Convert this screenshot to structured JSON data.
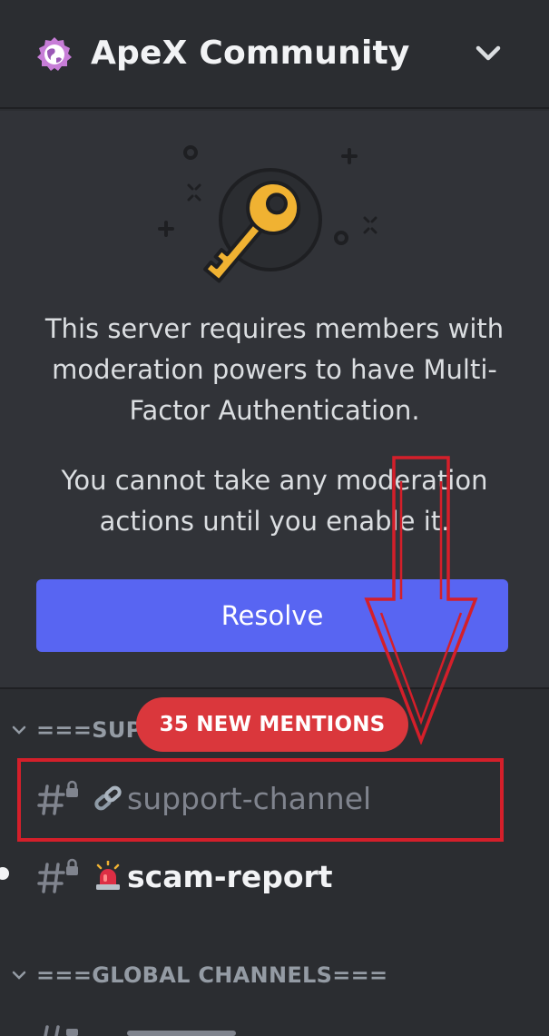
{
  "server": {
    "name": "ApeX Community",
    "icon": "globe-icon",
    "dropdown_icon": "chevron-down-icon"
  },
  "mfa_notice": {
    "illustration": "key-icon",
    "message": "This server requires members with moderation powers to have Multi-Factor Authentication.",
    "warning": "You cannot take any moderation actions until you enable it.",
    "resolve_label": "Resolve"
  },
  "mentions_pill": "35 NEW MENTIONS",
  "categories": [
    {
      "label": "===SUPP",
      "channels": [
        {
          "icon": "locked-hash-icon",
          "emoji": "link-icon",
          "name": "support-channel",
          "unread": false
        },
        {
          "icon": "locked-hash-icon",
          "emoji": "siren-icon",
          "name": "scam-report",
          "unread": true
        }
      ]
    },
    {
      "label": "===GLOBAL CHANNELS===",
      "channels": []
    }
  ],
  "annotation": {
    "color": "#d41f2a",
    "highlight": "red rectangle around support-channel",
    "arrow": "red down arrow pointing to channel"
  },
  "colors": {
    "accent": "#5865f2",
    "mention": "#da373c",
    "sidebar": "#2b2d31",
    "panel": "#313338"
  }
}
